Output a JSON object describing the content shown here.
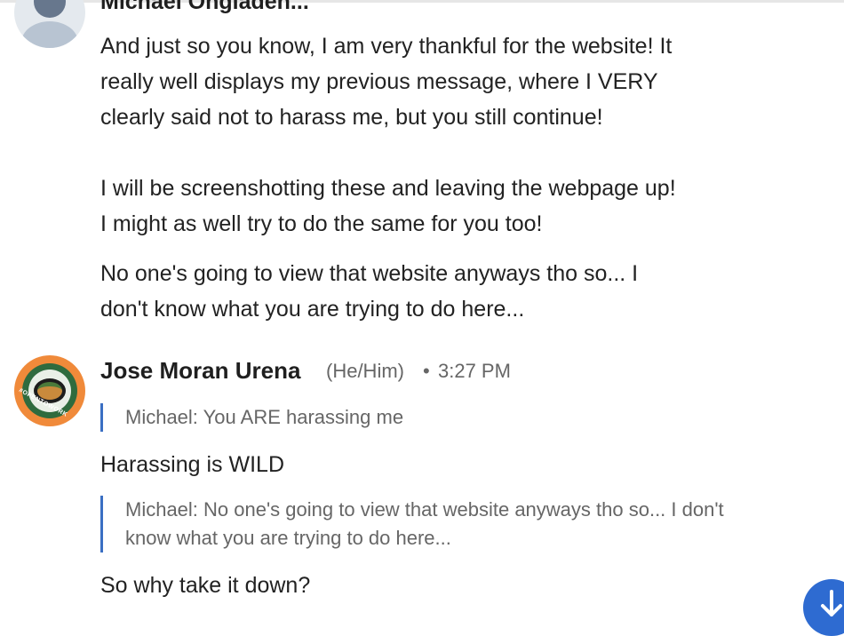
{
  "previous_sender": {
    "name": "Michael Ongiaden..."
  },
  "messages_prev": [
    {
      "text": "And just so you know, I am very thankful for the website! It\nreally well displays my previous message, where I VERY\nclearly said not to harass me, but you still continue!\n\nI will be screenshotting these and leaving the webpage up!\nI might as well try to do the same for you too!"
    },
    {
      "text": "No one's going to view that website anyways tho so... I\ndon't know what you are trying to do here..."
    }
  ],
  "sender": {
    "name": "Jose Moran Urena",
    "pronouns": "(He/Him)",
    "separator": "•",
    "time": "3:27 PM",
    "avatar_badge": "#OPENTOWORK"
  },
  "thread": [
    {
      "quote": "Michael: You ARE harassing me",
      "reply": "Harassing is WILD"
    },
    {
      "quote": "Michael: No one's going to view that website anyways tho so... I don't\nknow what you are trying to do here...",
      "reply": "So why take it down?"
    }
  ],
  "colors": {
    "accent": "#3b6fc3",
    "scroll_button": "#2e6bd1",
    "avatar_ring": "#f08a3a"
  },
  "icons": {
    "scroll_down": "arrow-down-icon"
  }
}
